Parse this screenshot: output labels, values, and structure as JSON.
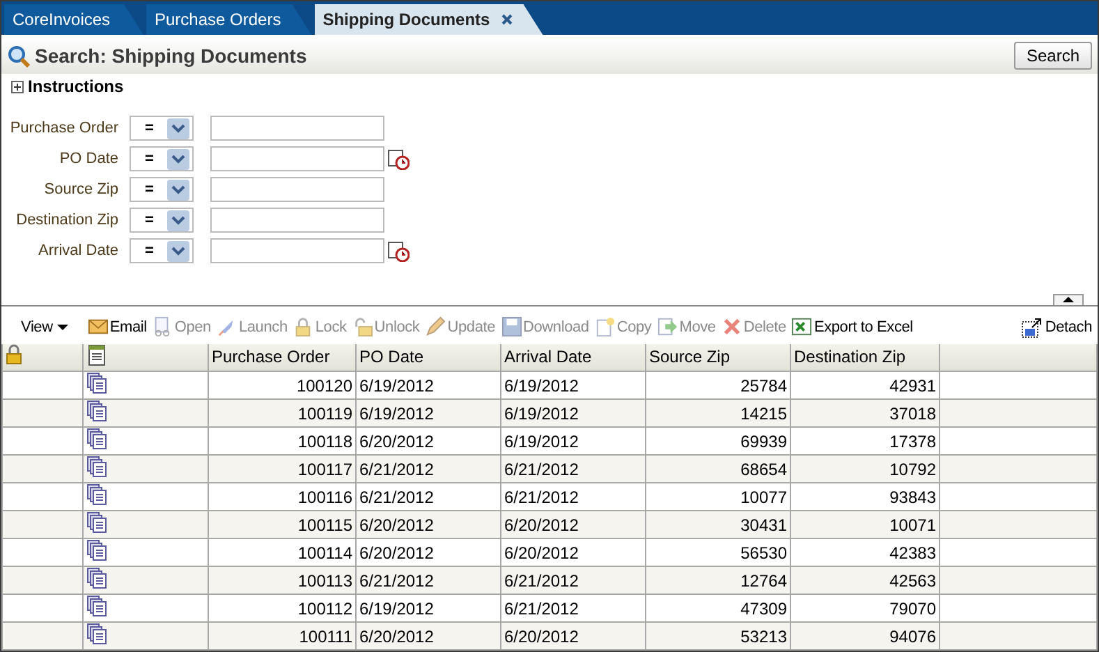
{
  "tabs": [
    {
      "label": "CoreInvoices",
      "selected": false
    },
    {
      "label": "Purchase Orders",
      "selected": false
    },
    {
      "label": "Shipping Documents",
      "selected": true
    }
  ],
  "search": {
    "title": "Search: Shipping Documents",
    "button": "Search",
    "instructions": {
      "label": "Instructions",
      "expanded": false
    },
    "fields": [
      {
        "label": "Purchase Order",
        "operator": "=",
        "kind": "text"
      },
      {
        "label": "PO Date",
        "operator": "=",
        "kind": "date"
      },
      {
        "label": "Source Zip",
        "operator": "=",
        "kind": "text"
      },
      {
        "label": "Destination Zip",
        "operator": "=",
        "kind": "text"
      },
      {
        "label": "Arrival Date",
        "operator": "=",
        "kind": "date"
      }
    ]
  },
  "toolbar": {
    "view": "View",
    "actions": [
      {
        "label": "Email",
        "disabled": false
      },
      {
        "label": "Open",
        "disabled": true
      },
      {
        "label": "Launch",
        "disabled": true
      },
      {
        "label": "Lock",
        "disabled": true
      },
      {
        "label": "Unlock",
        "disabled": true
      },
      {
        "label": "Update",
        "disabled": true
      },
      {
        "label": "Download",
        "disabled": true
      },
      {
        "label": "Copy",
        "disabled": true
      },
      {
        "label": "Move",
        "disabled": true
      },
      {
        "label": "Delete",
        "disabled": true
      },
      {
        "label": "Export to Excel",
        "disabled": false
      }
    ],
    "detach": "Detach"
  },
  "table": {
    "columns": [
      "Purchase Order",
      "PO Date",
      "Arrival Date",
      "Source Zip",
      "Destination Zip"
    ],
    "rows": [
      [
        "100120",
        "6/19/2012",
        "6/19/2012",
        "25784",
        "42931"
      ],
      [
        "100119",
        "6/19/2012",
        "6/19/2012",
        "14215",
        "37018"
      ],
      [
        "100118",
        "6/20/2012",
        "6/19/2012",
        "69939",
        "17378"
      ],
      [
        "100117",
        "6/21/2012",
        "6/21/2012",
        "68654",
        "10792"
      ],
      [
        "100116",
        "6/21/2012",
        "6/21/2012",
        "10077",
        "93843"
      ],
      [
        "100115",
        "6/20/2012",
        "6/20/2012",
        "30431",
        "10071"
      ],
      [
        "100114",
        "6/20/2012",
        "6/20/2012",
        "56530",
        "42383"
      ],
      [
        "100113",
        "6/21/2012",
        "6/21/2012",
        "12764",
        "42563"
      ],
      [
        "100112",
        "6/19/2012",
        "6/21/2012",
        "47309",
        "79070"
      ],
      [
        "100111",
        "6/20/2012",
        "6/20/2012",
        "53213",
        "94076"
      ]
    ]
  }
}
